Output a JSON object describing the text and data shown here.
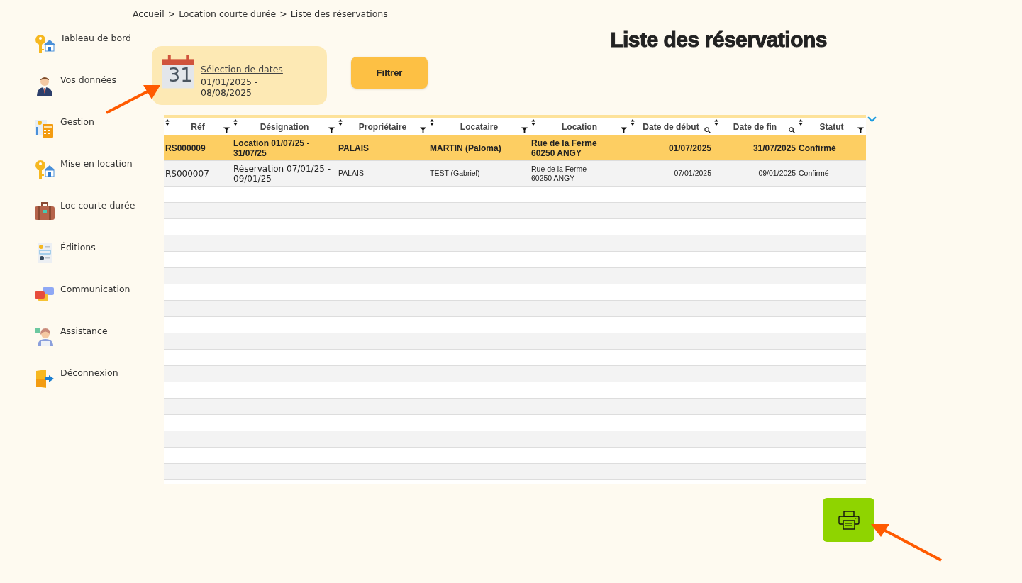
{
  "breadcrumb": [
    {
      "label": "Accueil",
      "link": true
    },
    {
      "label": ">",
      "link": false
    },
    {
      "label": "Location courte durée",
      "link": true
    },
    {
      "label": ">",
      "link": false
    },
    {
      "label": "Liste des réservations",
      "link": false
    }
  ],
  "sidebar": {
    "items": [
      {
        "label": "Tableau de bord"
      },
      {
        "label": "Vos données"
      },
      {
        "label": "Gestion"
      },
      {
        "label": "Mise en location"
      },
      {
        "label": "Loc courte durée"
      },
      {
        "label": "Éditions"
      },
      {
        "label": "Communication"
      },
      {
        "label": "Assistance"
      },
      {
        "label": "Déconnexion"
      }
    ]
  },
  "page_title": "Liste des réservations",
  "date_selection": {
    "day": "31",
    "label": "Sélection de dates",
    "range": "01/01/2025 - 08/08/2025"
  },
  "filter_button": "Filtrer",
  "table": {
    "columns": [
      {
        "label": "Réf",
        "kind": "filter"
      },
      {
        "label": "Désignation",
        "kind": "filter"
      },
      {
        "label": "Propriétaire",
        "kind": "filter"
      },
      {
        "label": "Locataire",
        "kind": "filter"
      },
      {
        "label": "Location",
        "kind": "filter"
      },
      {
        "label": "Date de début",
        "kind": "search"
      },
      {
        "label": "Date de fin",
        "kind": "search"
      },
      {
        "label": "Statut",
        "kind": "filter"
      }
    ],
    "rows": [
      {
        "selected": true,
        "cells": [
          "RS000009",
          "Location 01/07/25 - 31/07/25",
          "PALAIS",
          "MARTIN (Paloma)",
          "Rue de la Ferme\n60250 ANGY",
          "01/07/2025",
          "31/07/2025",
          "Confirmé"
        ]
      },
      {
        "selected": false,
        "cells": [
          "RS000007",
          "Réservation 07/01/25 - 09/01/25",
          "PALAIS",
          "TEST (Gabriel)",
          "Rue de la Ferme\n60250 ANGY",
          "07/01/2025",
          "09/01/2025",
          "Confirmé"
        ]
      }
    ]
  }
}
